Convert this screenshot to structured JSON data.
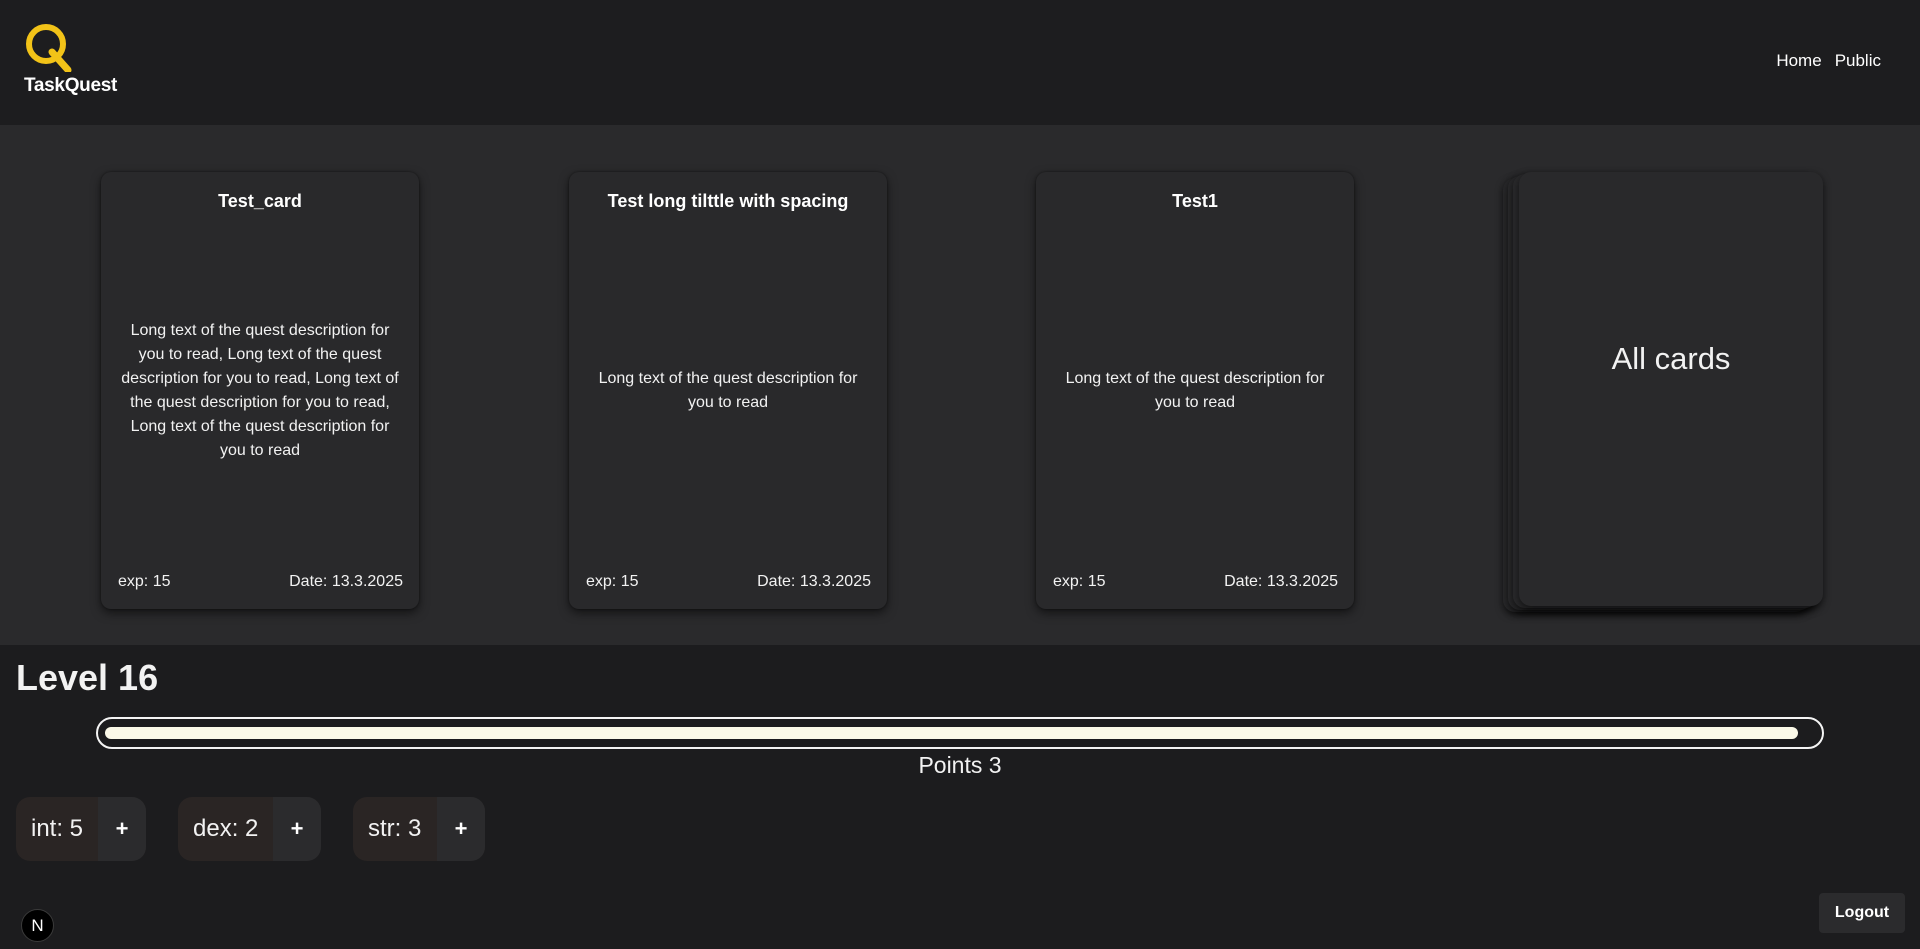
{
  "header": {
    "logo_text": "TaskQuest",
    "brand_color": "#f2c318",
    "nav": [
      {
        "label": "Home"
      },
      {
        "label": "Public"
      }
    ]
  },
  "cards": [
    {
      "title": "Test_card",
      "description": "Long text of the quest description for you to read, Long text of the quest description for you to read, Long text of the quest description for you to read, Long text of the quest description for you to read",
      "exp": "exp: 15",
      "date": "Date: 13.3.2025"
    },
    {
      "title": "Test long tilttle with spacing",
      "description": "Long text of the quest description for you to read",
      "exp": "exp: 15",
      "date": "Date: 13.3.2025"
    },
    {
      "title": "Test1",
      "description": "Long text of the quest description for you to read",
      "exp": "exp: 15",
      "date": "Date: 13.3.2025"
    }
  ],
  "deck": {
    "label": "All cards"
  },
  "level": {
    "title": "Level 16",
    "progress_fraction": 0.99,
    "points_label": "Points 3"
  },
  "stats": [
    {
      "label": "int: 5",
      "button": "+"
    },
    {
      "label": "dex: 2",
      "button": "+"
    },
    {
      "label": "str: 3",
      "button": "+"
    }
  ],
  "footer": {
    "badge": "N",
    "logout_label": "Logout"
  }
}
